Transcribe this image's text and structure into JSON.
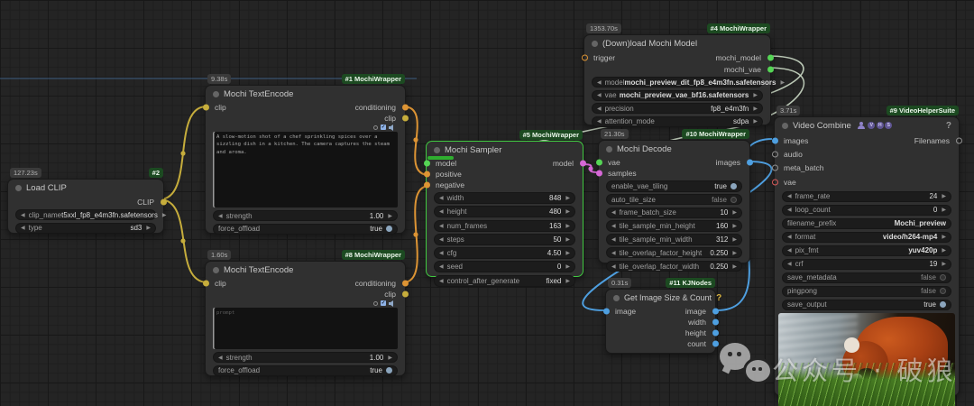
{
  "colors": {
    "link_clip": "#c6ad3c",
    "link_cond": "#dd9434",
    "link_model": "#ccdac6",
    "link_latent": "#d668d6",
    "link_image": "#4e9fe0",
    "faint_line": "#3c5a7a",
    "slot_green": "#55d555",
    "slot_orange": "#dd9434",
    "slot_yellow": "#c6ad3c",
    "slot_pink": "#d668d6",
    "slot_blue": "#4e9fe0",
    "slot_gray": "#909090",
    "slot_red": "#d95b5b"
  },
  "watermark": {
    "text": "公众号 · 破狼"
  },
  "nodes": {
    "n2": {
      "time": "127.23s",
      "badge": "#2",
      "title": "Load CLIP",
      "outputs": [
        "CLIP"
      ],
      "widgets": [
        {
          "label": "clip_name",
          "value": "t5xxl_fp8_e4m3fn.safetensors"
        },
        {
          "label": "type",
          "value": "sd3"
        }
      ]
    },
    "n1": {
      "time": "9.38s",
      "badge": "#1 MochiWrapper",
      "title": "Mochi TextEncode",
      "inputs": [
        "clip"
      ],
      "outputs": [
        "conditioning",
        "clip"
      ],
      "prompt": "A slow-motion shot of a chef sprinkling spices over a sizzling dish in a kitchen. The camera captures the steam and aroma.",
      "widgets": [
        {
          "label": "strength",
          "value": "1.00"
        },
        {
          "label": "force_offload",
          "value": "true"
        }
      ]
    },
    "n8": {
      "time": "1.60s",
      "badge": "#8 MochiWrapper",
      "title": "Mochi TextEncode",
      "inputs": [
        "clip"
      ],
      "outputs": [
        "conditioning",
        "clip"
      ],
      "prompt_placeholder": "prompt",
      "widgets": [
        {
          "label": "strength",
          "value": "1.00"
        },
        {
          "label": "force_offload",
          "value": "true"
        }
      ]
    },
    "n5": {
      "badge": "#5 MochiWrapper",
      "title": "Mochi Sampler",
      "inputs": [
        "model",
        "positive",
        "negative"
      ],
      "outputs": [
        "model"
      ],
      "widgets": [
        {
          "label": "width",
          "value": "848"
        },
        {
          "label": "height",
          "value": "480"
        },
        {
          "label": "num_frames",
          "value": "163"
        },
        {
          "label": "steps",
          "value": "50"
        },
        {
          "label": "cfg",
          "value": "4.50"
        },
        {
          "label": "seed",
          "value": "0"
        },
        {
          "label": "control_after_generate",
          "value": "fixed"
        }
      ]
    },
    "n4": {
      "time": "1353.70s",
      "badge": "#4 MochiWrapper",
      "title": "(Down)load Mochi Model",
      "inputs": [
        "trigger"
      ],
      "outputs": [
        "mochi_model",
        "mochi_vae"
      ],
      "widgets": [
        {
          "label": "model",
          "value": "mochi_preview_dit_fp8_e4m3fn.safetensors"
        },
        {
          "label": "vae",
          "value": "mochi_preview_vae_bf16.safetensors"
        },
        {
          "label": "precision",
          "value": "fp8_e4m3fn"
        },
        {
          "label": "attention_mode",
          "value": "sdpa"
        }
      ]
    },
    "n10": {
      "time": "21.30s",
      "badge": "#10 MochiWrapper",
      "title": "Mochi Decode",
      "inputs": [
        "vae",
        "samples"
      ],
      "outputs": [
        "images"
      ],
      "widgets": [
        {
          "label": "enable_vae_tiling",
          "value": "true"
        },
        {
          "label": "auto_tile_size",
          "value": "false"
        },
        {
          "label": "frame_batch_size",
          "value": "10"
        },
        {
          "label": "tile_sample_min_height",
          "value": "160"
        },
        {
          "label": "tile_sample_min_width",
          "value": "312"
        },
        {
          "label": "tile_overlap_factor_height",
          "value": "0.250"
        },
        {
          "label": "tile_overlap_factor_width",
          "value": "0.250"
        }
      ]
    },
    "n11": {
      "time": "0.31s",
      "badge": "#11 KJNodes",
      "title": "Get Image Size & Count",
      "help": "?",
      "inputs": [
        "image"
      ],
      "outputs": [
        "image",
        "width",
        "height",
        "count"
      ]
    },
    "n9": {
      "time": "3.71s",
      "badge": "#9 VideoHelperSuite",
      "title": "Video Combine",
      "help": "?",
      "vhs_letters": [
        "V",
        "H",
        "S"
      ],
      "inputs": [
        "images",
        "audio",
        "meta_batch",
        "vae"
      ],
      "outputs": [
        "Filenames"
      ],
      "widgets": [
        {
          "label": "frame_rate",
          "value": "24"
        },
        {
          "label": "loop_count",
          "value": "0"
        },
        {
          "label": "filename_prefix",
          "value": "Mochi_preview"
        },
        {
          "label": "format",
          "value": "video/h264-mp4"
        },
        {
          "label": "pix_fmt",
          "value": "yuv420p"
        },
        {
          "label": "crf",
          "value": "19"
        },
        {
          "label": "save_metadata",
          "value": "false"
        },
        {
          "label": "pingpong",
          "value": "false"
        },
        {
          "label": "save_output",
          "value": "true"
        }
      ]
    }
  }
}
